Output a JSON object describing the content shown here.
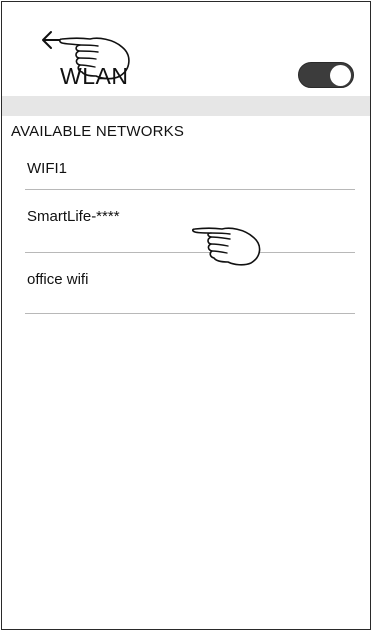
{
  "header": {
    "title": "WLAN",
    "back_icon": "arrow-left-icon",
    "toggle_state": "on"
  },
  "section": {
    "title": "AVAILABLE NETWORKS"
  },
  "networks": [
    {
      "label": "WIFI1"
    },
    {
      "label": "SmartLife-****"
    },
    {
      "label": "office wifi"
    }
  ],
  "annotations": {
    "pointer_icon": "pointing-hand-icon"
  }
}
